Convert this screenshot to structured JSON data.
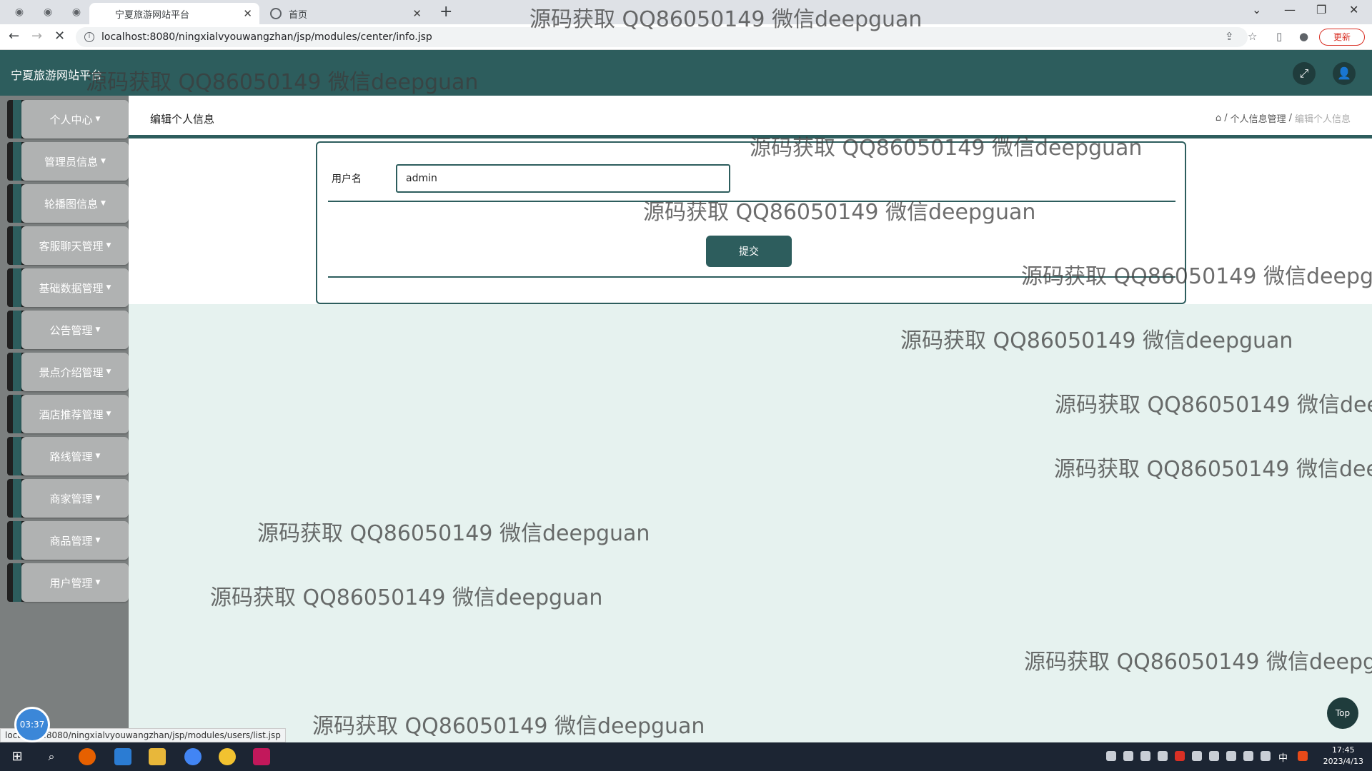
{
  "browser": {
    "tabs": [
      {
        "title": "宁夏旅游网站平台",
        "active": true
      },
      {
        "title": "首页",
        "active": false
      }
    ],
    "url": "localhost:8080/ningxialvyouwangzhan/jsp/modules/center/info.jsp",
    "update_label": "更新",
    "status_url": "localhost:8080/ningxialvyouwangzhan/jsp/modules/users/list.jsp"
  },
  "header": {
    "title": "宁夏旅游网站平台"
  },
  "sidebar": {
    "items": [
      {
        "label": "个人中心"
      },
      {
        "label": "管理员信息"
      },
      {
        "label": "轮播图信息"
      },
      {
        "label": "客服聊天管理"
      },
      {
        "label": "基础数据管理"
      },
      {
        "label": "公告管理"
      },
      {
        "label": "景点介绍管理"
      },
      {
        "label": "酒店推荐管理"
      },
      {
        "label": "路线管理"
      },
      {
        "label": "商家管理"
      },
      {
        "label": "商品管理"
      },
      {
        "label": "用户管理"
      }
    ]
  },
  "page": {
    "heading": "编辑个人信息",
    "breadcrumb": [
      "个人信息管理",
      "编辑个人信息"
    ]
  },
  "form": {
    "username_label": "用户名",
    "username_value": "admin",
    "submit_label": "提交"
  },
  "misc": {
    "top_label": "Top",
    "timer": "03:37"
  },
  "taskbar": {
    "time": "17:45",
    "date": "2023/4/13",
    "ime": "中"
  },
  "watermark": "源码获取 QQ86050149 微信deepguan",
  "colors": {
    "primary": "#2d5d5d",
    "content_bg": "#e6f2ef",
    "sidebar_bg": "#7b7f7f"
  }
}
